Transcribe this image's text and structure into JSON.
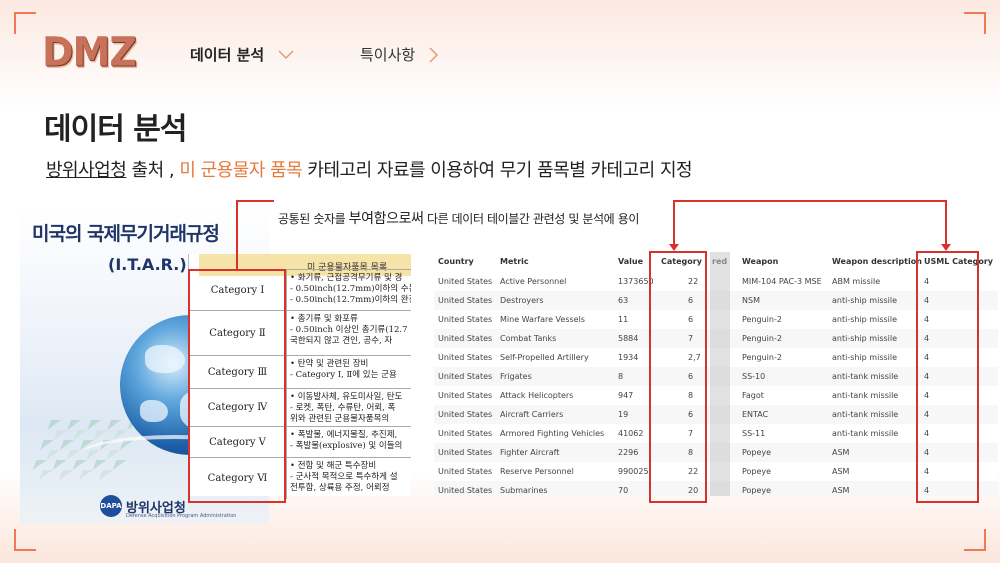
{
  "brand": {
    "logo": "DMZ"
  },
  "nav": {
    "items": [
      {
        "label": "데이터 분석",
        "active": true
      },
      {
        "label": "특이사항",
        "active": false
      }
    ]
  },
  "page": {
    "title": "데이터 분석",
    "subtitle_source": "방위사업청",
    "subtitle_mid": " 출처 , ",
    "subtitle_highlight": "미 군용물자 품목",
    "subtitle_rest": " 카테고리 자료를 이용하여 무기 품목별 카테고리 지정",
    "note_pre": "공통된 숫자를 ",
    "note_big": "부여함으로써",
    "note_post": " 다른 데이터 테이블간 관련성 및 분석에 용이"
  },
  "book": {
    "title": "미국의 국제무기거래규정",
    "subtitle": "(I.T.A.R.)",
    "publisher": "방위사업청",
    "publisher_en": "Defense Acquisition Program Administration",
    "badge": "DAPA"
  },
  "document": {
    "header": "미 군용물자품목 목록",
    "rows": [
      {
        "category": "Category Ⅰ",
        "lines": [
          "• 화기류, 근접공격무기류 및 경",
          "- 0.50inch(12.7mm)이하의 수동",
          "- 0.50inch(12.7mm)이하의 완전"
        ]
      },
      {
        "category": "Category Ⅱ",
        "lines": [
          "• 총기류 및 화포류",
          "- 0.50inch 이상인 총기류(12.7",
          "  국한되지 않고 견인, 공수, 자"
        ]
      },
      {
        "category": "Category Ⅲ",
        "lines": [
          "• 탄약 및 관련된 장비",
          "- Category Ⅰ, Ⅱ에 있는 군용"
        ]
      },
      {
        "category": "Category Ⅳ",
        "lines": [
          "• 이동발사체, 유도미사일, 탄도",
          "- 로켓, 폭탄, 수류탄, 어뢰, 폭",
          "  위와 관련된 군용물자품목의"
        ]
      },
      {
        "category": "Category Ⅴ",
        "lines": [
          "• 폭발물, 에너지물질, 추진제,",
          "- 폭발물(explosive) 및 이들의"
        ]
      },
      {
        "category": "Category Ⅵ",
        "lines": [
          "• 전함 및 해군 특수장비",
          "- 군사적 목적으로 특수하게 설",
          "  전투함, 상륙용 주정, 어뢰정"
        ]
      }
    ]
  },
  "table": {
    "headers": [
      "Country",
      "Metric",
      "Value",
      "Category",
      "red",
      "Weapon designation",
      "Weapon description",
      "USML Category"
    ],
    "rows": [
      [
        "United States",
        "Active Personnel",
        "1373650",
        "22",
        "MIM-104 PAC-3 MSE",
        "ABM missile",
        "4"
      ],
      [
        "United States",
        "Destroyers",
        "63",
        "6",
        "NSM",
        "anti-ship missile",
        "4"
      ],
      [
        "United States",
        "Mine Warfare Vessels",
        "11",
        "6",
        "Penguin-2",
        "anti-ship missile",
        "4"
      ],
      [
        "United States",
        "Combat Tanks",
        "5884",
        "7",
        "Penguin-2",
        "anti-ship missile",
        "4"
      ],
      [
        "United States",
        "Self-Propelled Artillery",
        "1934",
        "2,7",
        "Penguin-2",
        "anti-ship missile",
        "4"
      ],
      [
        "United States",
        "Frigates",
        "8",
        "6",
        "SS-10",
        "anti-tank missile",
        "4"
      ],
      [
        "United States",
        "Attack Helicopters",
        "947",
        "8",
        "Fagot",
        "anti-tank missile",
        "4"
      ],
      [
        "United States",
        "Aircraft Carriers",
        "19",
        "6",
        "ENTAC",
        "anti-tank missile",
        "4"
      ],
      [
        "United States",
        "Armored Fighting Vehicles",
        "41062",
        "7",
        "SS-11",
        "anti-tank missile",
        "4"
      ],
      [
        "United States",
        "Fighter Aircraft",
        "2296",
        "8",
        "Popeye",
        "ASM",
        "4"
      ],
      [
        "United States",
        "Reserve Personnel",
        "990025",
        "22",
        "Popeye",
        "ASM",
        "4"
      ],
      [
        "United States",
        "Submarines",
        "70",
        "20",
        "Popeye",
        "ASM",
        "4"
      ]
    ]
  },
  "colors": {
    "accent": "#e57a3c",
    "highlight_box": "#d9322b",
    "corner": "#ee7a55"
  }
}
